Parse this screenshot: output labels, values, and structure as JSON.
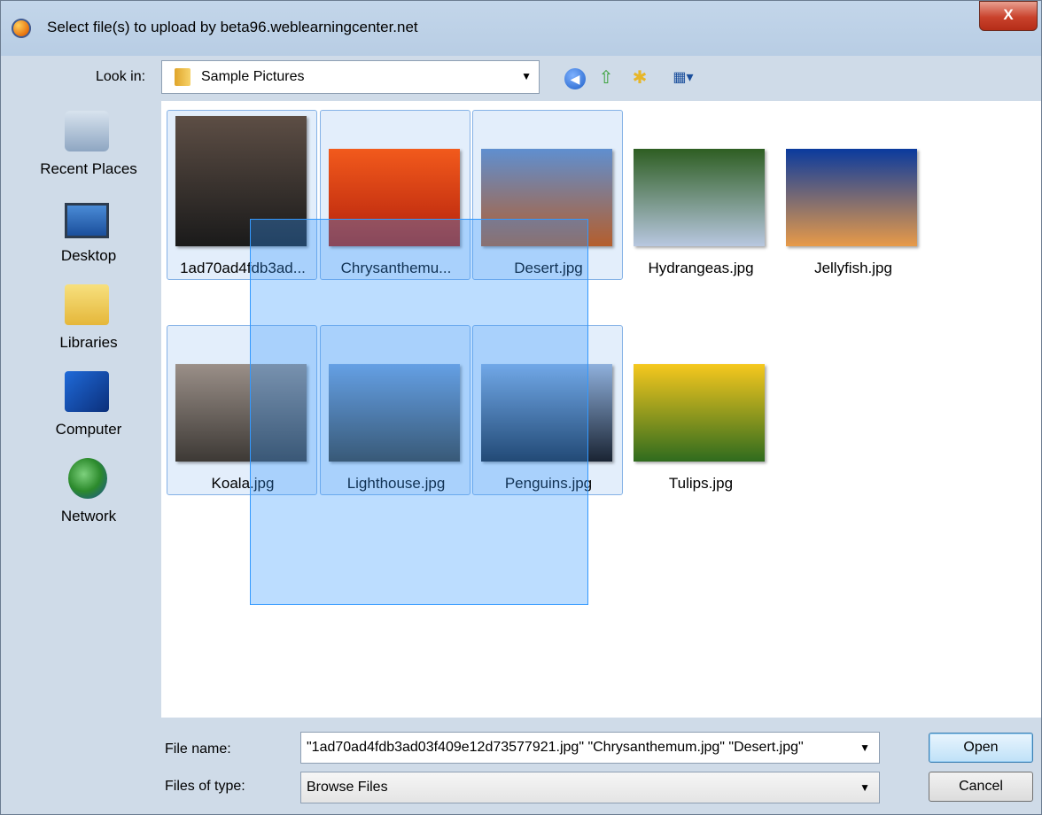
{
  "window": {
    "title": "Select file(s) to upload by beta96.weblearningcenter.net",
    "close_label": "X"
  },
  "look_in": {
    "label": "Look in:",
    "value": "Sample Pictures"
  },
  "toolbar": {
    "back_icon": "back-arrow-icon",
    "up_icon": "up-folder-icon",
    "new_icon": "new-folder-icon",
    "view_icon": "view-menu-icon"
  },
  "places": [
    {
      "label": "Recent Places",
      "icon": "recent-places-icon"
    },
    {
      "label": "Desktop",
      "icon": "desktop-icon"
    },
    {
      "label": "Libraries",
      "icon": "libraries-icon"
    },
    {
      "label": "Computer",
      "icon": "computer-icon"
    },
    {
      "label": "Network",
      "icon": "network-icon"
    }
  ],
  "files": [
    {
      "name": "1ad70ad4fdb3ad...",
      "selected": true,
      "colors": [
        "#5d4e45",
        "#1a1a1a"
      ]
    },
    {
      "name": "Chrysanthemu...",
      "selected": true,
      "colors": [
        "#f25a1c",
        "#b3200c"
      ]
    },
    {
      "name": "Desert.jpg",
      "selected": true,
      "colors": [
        "#5f8fd0",
        "#b55e2c"
      ]
    },
    {
      "name": "Hydrangeas.jpg",
      "selected": false,
      "colors": [
        "#2e5e22",
        "#b8c7e0"
      ]
    },
    {
      "name": "Jellyfish.jpg",
      "selected": false,
      "colors": [
        "#0a3a9e",
        "#e89a48"
      ]
    },
    {
      "name": "Koala.jpg",
      "selected": true,
      "colors": [
        "#9a8f88",
        "#3d3935"
      ]
    },
    {
      "name": "Lighthouse.jpg",
      "selected": true,
      "colors": [
        "#7da4d8",
        "#3b3b35"
      ]
    },
    {
      "name": "Penguins.jpg",
      "selected": true,
      "colors": [
        "#8fb0dc",
        "#1a2433"
      ]
    },
    {
      "name": "Tulips.jpg",
      "selected": false,
      "colors": [
        "#f6c81e",
        "#2f6b1e"
      ]
    }
  ],
  "file_name": {
    "label": "File name:",
    "value": "\"1ad70ad4fdb3ad03f409e12d73577921.jpg\" \"Chrysanthemum.jpg\" \"Desert.jpg\""
  },
  "file_type": {
    "label": "Files of type:",
    "value": "Browse Files"
  },
  "buttons": {
    "open": "Open",
    "cancel": "Cancel"
  }
}
